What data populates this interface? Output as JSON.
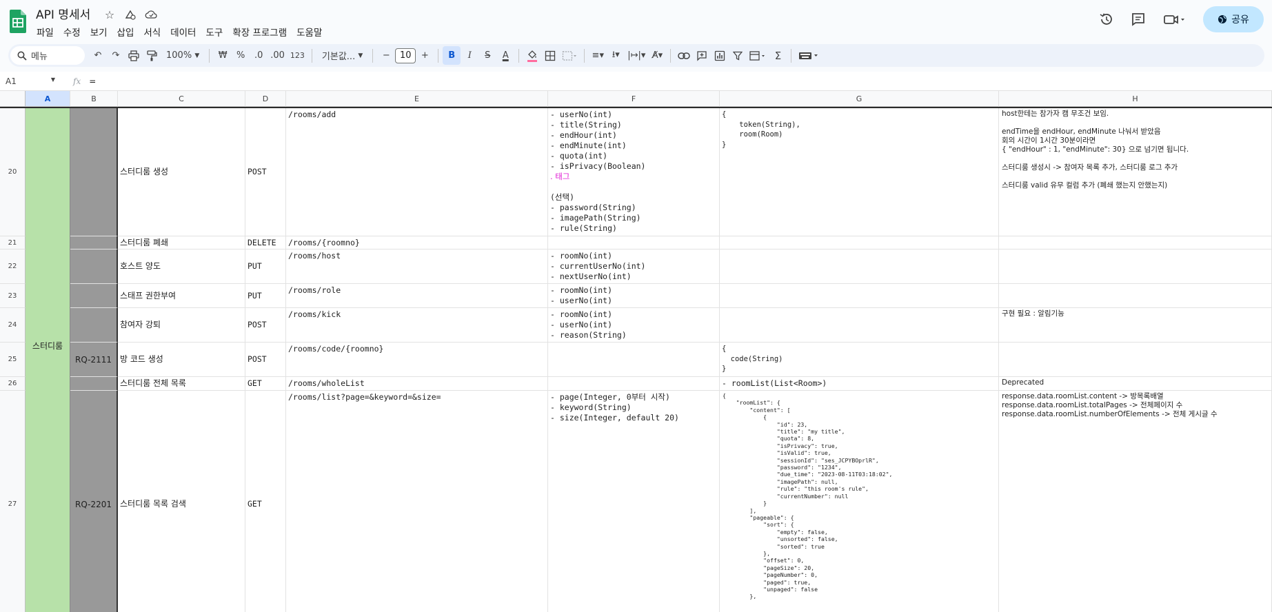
{
  "doc": {
    "title": "API 명세서"
  },
  "menu": [
    "파일",
    "수정",
    "보기",
    "삽입",
    "서식",
    "데이터",
    "도구",
    "확장 프로그램",
    "도움말"
  ],
  "header": {
    "share_label": "공유"
  },
  "toolbar": {
    "search_placeholder": "메뉴",
    "zoom": "100%",
    "currency": "₩",
    "percent": "%",
    "dec_decrease": ".0",
    "dec_increase": ".00",
    "number_format": "123",
    "font_family": "기본값...",
    "font_size": "10",
    "bold": "B",
    "italic": "I",
    "strike": "S",
    "text_color": "A"
  },
  "formula": {
    "cell_ref": "A1",
    "content": "="
  },
  "colors": {
    "green": "#b7e1a9",
    "gray": "#999999",
    "accent": "#0b57d0",
    "magenta": "#e01bd4"
  },
  "columns": [
    "A",
    "B",
    "C",
    "D",
    "E",
    "F",
    "G",
    "H"
  ],
  "rows": [
    {
      "num": "20",
      "c": "스터디룸 생성",
      "d": "POST",
      "e": "/rooms/add",
      "f": "- userNo(int)\n- title(String)\n- endHour(int)\n- endMinute(int)\n- quota(int)\n- isPrivacy(Boolean)",
      "f_tag": ". 태그",
      "f_extra": "(선택)\n- password(String)\n- imagePath(String)\n- rule(String)",
      "g": "{\n    token(String),\n    room(Room)\n}",
      "h": "host한테는 참가자 캠 무조건 보임.\n\nendTime을 endHour, endMinute 나눠서 받았음\n회의 시간이 1시간 30분이라면\n{ \"endHour\" : 1, \"endMinute\": 30} 으로 넘기면 됩니다.\n\n스터디룸 생성시 -> 참여자 목록 추가, 스터디룸 로그 추가\n\n스터디룸 valid 유무 컬럼 추가 (폐쇄 했는지 안했는지)"
    },
    {
      "num": "21",
      "c": "스터디룸 폐쇄",
      "d": "DELETE",
      "e": "/rooms/{roomno}",
      "f": "",
      "g": "",
      "h": ""
    },
    {
      "num": "22",
      "c": "호스트 양도",
      "d": "PUT",
      "e": "/rooms/host",
      "f": "- roomNo(int)\n- currentUserNo(int)\n- nextUserNo(int)",
      "g": "",
      "h": ""
    },
    {
      "num": "23",
      "c": "스태프 권한부여",
      "d": "PUT",
      "e": "/rooms/role",
      "f": "- roomNo(int)\n- userNo(int)",
      "g": "",
      "h": ""
    },
    {
      "num": "24",
      "c": "참여자 강퇴",
      "d": "POST",
      "e": "/rooms/kick",
      "f": "- roomNo(int)\n- userNo(int)\n- reason(String)",
      "g": "",
      "h": "구현 필요 : 알림기능"
    },
    {
      "num": "25",
      "b": "RQ-2111",
      "c": "방 코드 생성",
      "d": "POST",
      "e": "/rooms/code/{roomno}",
      "f": "",
      "g": "{\n  code(String)\n}",
      "h": ""
    },
    {
      "num": "26",
      "c": "스터디룸 전체 목록",
      "d": "GET",
      "e": "/rooms/wholeList",
      "f": "",
      "g": "- roomList(List<Room>)",
      "h": "Deprecated"
    },
    {
      "num": "27",
      "a": "스터디룸",
      "b": "RQ-2201",
      "c": "스터디룸 목록 검색",
      "d": "GET",
      "e": "/rooms/list?page=&keyword=&size=",
      "f": "- page(Integer, 0부터 시작)\n- keyword(String)\n- size(Integer, default 20)",
      "g": "{\n    \"roomList\": {\n        \"content\": [\n            {\n                \"id\": 23,\n                \"title\": \"my title\",\n                \"quota\": 8,\n                \"isPrivacy\": true,\n                \"isValid\": true,\n                \"sessionId\": \"ses_JCPYBOprlR\",\n                \"password\": \"1234\",\n                \"due_time\": \"2023-08-11T03:18:02\",\n                \"imagePath\": null,\n                \"rule\": \"this room's rule\",\n                \"currentNumber\": null\n            }\n        ],\n        \"pageable\": {\n            \"sort\": {\n                \"empty\": false,\n                \"unsorted\": false,\n                \"sorted\": true\n            },\n            \"offset\": 0,\n            \"pageSize\": 20,\n            \"pageNumber\": 0,\n            \"paged\": true,\n            \"unpaged\": false\n        },",
      "h": "response.data.roomList.content -> 방목록배열\nresponse.data.roomList.totalPages -> 전체페이지 수\nresponse.data.roomList.numberOfElements -> 전체 게시글 수"
    }
  ]
}
